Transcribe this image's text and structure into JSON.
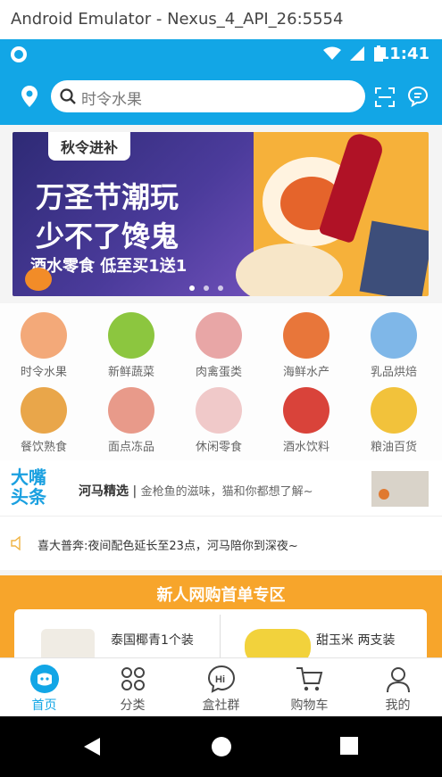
{
  "window": {
    "title": "Android Emulator - Nexus_4_API_26:5554"
  },
  "status_bar": {
    "time": "11:41"
  },
  "search": {
    "placeholder": "时令水果"
  },
  "banner": {
    "tag": "秋令进补",
    "headline_1": "万圣节潮玩",
    "headline_2": "少不了馋鬼",
    "subline": "酒水零食 低至买1送1",
    "page_dots": 3,
    "active_dot": 0
  },
  "categories": [
    {
      "label": "时令水果",
      "icon": "melon-icon",
      "color": "#f3a979"
    },
    {
      "label": "新鲜蔬菜",
      "icon": "corn-icon",
      "color": "#8cc63f"
    },
    {
      "label": "肉禽蛋类",
      "icon": "meat-icon",
      "color": "#e8a6a6"
    },
    {
      "label": "海鲜水产",
      "icon": "crab-icon",
      "color": "#e8763a"
    },
    {
      "label": "乳品烘焙",
      "icon": "milk-icon",
      "color": "#7fb7e8"
    },
    {
      "label": "餐饮熟食",
      "icon": "fried-food-icon",
      "color": "#e9a64a"
    },
    {
      "label": "面点冻品",
      "icon": "dumpling-icon",
      "color": "#e89a8a"
    },
    {
      "label": "休闲零食",
      "icon": "fries-icon",
      "color": "#f0c9c9"
    },
    {
      "label": "酒水饮料",
      "icon": "liquor-icon",
      "color": "#d9433a"
    },
    {
      "label": "粮油百货",
      "icon": "oil-icon",
      "color": "#f2c23b"
    }
  ],
  "news": {
    "brand_line1": "大嘴",
    "brand_line2": "头条",
    "tag": "河马精选",
    "separator": "|",
    "text": "金枪鱼的滋味，猫和你都想了解~"
  },
  "notice": {
    "text": "喜大普奔:夜间配色延长至23点，河马陪你到深夜~"
  },
  "promo": {
    "header": "新人网购首单专区",
    "items": [
      {
        "name": "泰国椰青1个装"
      },
      {
        "name": "甜玉米 两支装"
      }
    ]
  },
  "tabs": [
    {
      "label": "首页",
      "icon": "home-face-icon",
      "active": true
    },
    {
      "label": "分类",
      "icon": "category-grid-icon",
      "active": false
    },
    {
      "label": "盒社群",
      "icon": "hi-bubble-icon",
      "active": false
    },
    {
      "label": "购物车",
      "icon": "cart-icon",
      "active": false
    },
    {
      "label": "我的",
      "icon": "person-icon",
      "active": false
    }
  ],
  "colors": {
    "accent": "#12a6e6",
    "promo": "#f7a52b"
  }
}
